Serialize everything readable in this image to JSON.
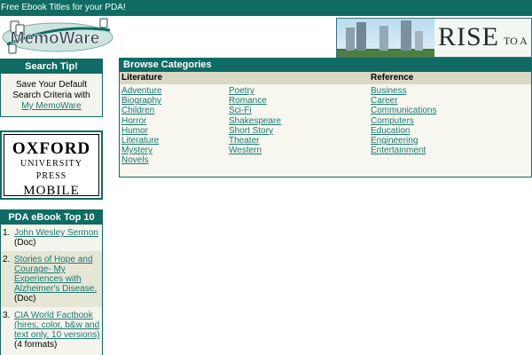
{
  "topbar": {
    "text": "Free Ebook Titles for your PDA!"
  },
  "logo": {
    "text": "MemoWare"
  },
  "banner": {
    "headline": "RISE",
    "subtext": "TO A"
  },
  "search_tip": {
    "title": "Search Tip!",
    "line1": "Save Your Default",
    "line2": "Search Criteria with",
    "link": "My MemoWare"
  },
  "oxford": {
    "line1": "OXFORD",
    "line2": "UNIVERSITY PRESS",
    "line3": "MOBILE"
  },
  "top10": {
    "title": "PDA eBook Top 10",
    "items": [
      {
        "num": "1.",
        "title": "John Wesley Sermon",
        "format": "(Doc)"
      },
      {
        "num": "2.",
        "title": "Stories of Hope and Courage- My Experiences with Alzheimer's Disease.",
        "format": "(Doc)"
      },
      {
        "num": "3.",
        "title": "CIA World Factbook (hires, color, b&w and text only, 10 versions)",
        "format": "(4 formats)"
      }
    ]
  },
  "browse": {
    "title": "Browse Categories",
    "literature_label": "Literature",
    "reference_label": "Reference",
    "col1": [
      "Adventure",
      "Biography",
      "Children",
      "Horror",
      "Humor",
      "Literature",
      "Mystery",
      "Novels"
    ],
    "col2": [
      "Poetry",
      "Romance",
      "Sci-Fi",
      "Shakespeare",
      "Short Story",
      "Theater",
      "Western"
    ],
    "col3": [
      "Business",
      "Career",
      "Communications",
      "Computers",
      "Education",
      "Engineering",
      "Entertainment"
    ]
  }
}
